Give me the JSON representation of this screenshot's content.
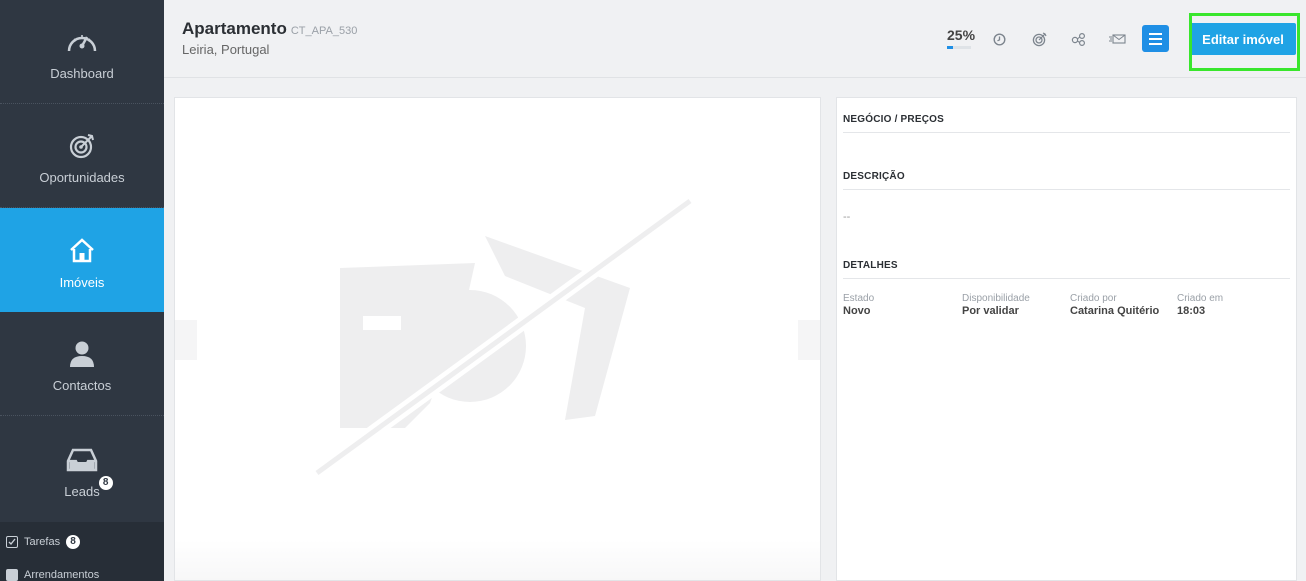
{
  "sidebar": {
    "items": [
      {
        "label": "Dashboard",
        "icon": "gauge-icon"
      },
      {
        "label": "Oportunidades",
        "icon": "target-icon"
      },
      {
        "label": "Imóveis",
        "icon": "home-icon"
      },
      {
        "label": "Contactos",
        "icon": "person-icon"
      },
      {
        "label": "Leads",
        "icon": "inbox-icon",
        "badge": "8"
      }
    ],
    "mini": [
      {
        "label": "Tarefas",
        "badge": "8"
      },
      {
        "label": "Arrendamentos"
      }
    ]
  },
  "header": {
    "title": "Apartamento",
    "code": "CT_APA_530",
    "location": "Leiria, Portugal",
    "completion": "25%",
    "completion_value": 0.25,
    "edit_label": "Editar imóvel"
  },
  "info": {
    "business_title": "NEGÓCIO / PREÇOS",
    "description_title": "DESCRIÇÃO",
    "description_value": "--",
    "details_title": "DETALHES",
    "details": [
      {
        "key": "Estado",
        "value": "Novo"
      },
      {
        "key": "Disponibilidade",
        "value": "Por validar"
      },
      {
        "key": "Criado por",
        "value": "Catarina Quitério"
      },
      {
        "key": "Criado em",
        "value": "18:03"
      }
    ]
  },
  "colors": {
    "sidebar": "#2f3742",
    "active": "#1fa3e5",
    "primary": "#1f8fe5",
    "highlight": "#39e62c"
  }
}
